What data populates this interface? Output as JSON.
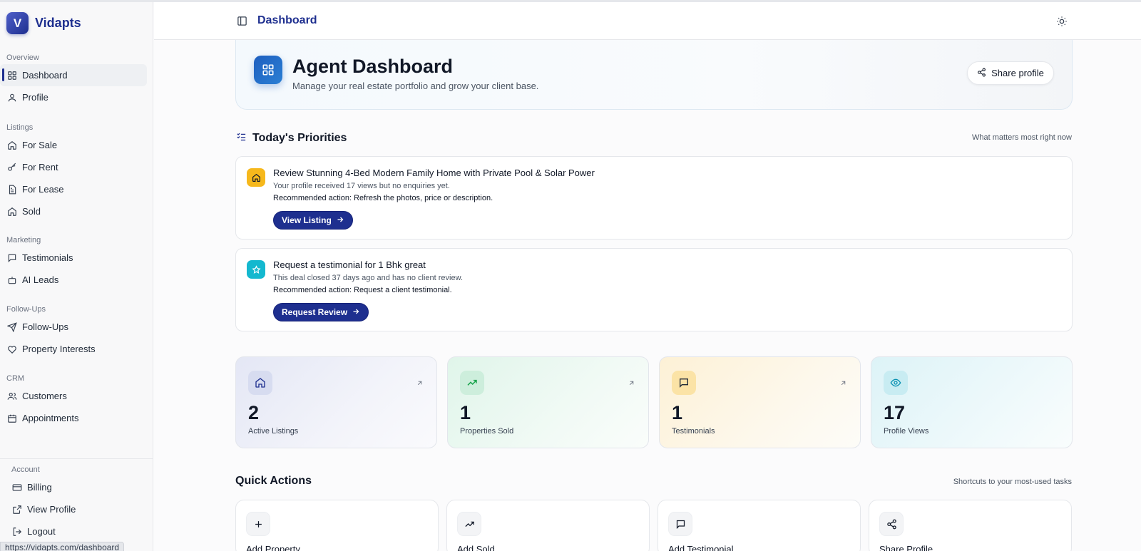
{
  "brand": {
    "logo_letter": "V",
    "name": "Vidapts"
  },
  "sidebar": {
    "sections": [
      {
        "heading": "Overview",
        "items": [
          {
            "label": "Dashboard",
            "icon": "grid-icon",
            "active": true
          },
          {
            "label": "Profile",
            "icon": "user-icon"
          }
        ]
      },
      {
        "heading": "Listings",
        "items": [
          {
            "label": "For Sale",
            "icon": "house-icon"
          },
          {
            "label": "For Rent",
            "icon": "key-icon"
          },
          {
            "label": "For Lease",
            "icon": "document-icon"
          },
          {
            "label": "Sold",
            "icon": "house-icon"
          }
        ]
      },
      {
        "heading": "Marketing",
        "items": [
          {
            "label": "Testimonials",
            "icon": "chat-icon"
          },
          {
            "label": "AI Leads",
            "icon": "bot-icon"
          }
        ]
      },
      {
        "heading": "Follow-Ups",
        "items": [
          {
            "label": "Follow-Ups",
            "icon": "send-icon"
          },
          {
            "label": "Property Interests",
            "icon": "heart-icon"
          }
        ]
      },
      {
        "heading": "CRM",
        "items": [
          {
            "label": "Customers",
            "icon": "users-icon"
          },
          {
            "label": "Appointments",
            "icon": "calendar-icon"
          }
        ]
      }
    ],
    "account": {
      "heading": "Account",
      "items": [
        {
          "label": "Billing",
          "icon": "card-icon"
        },
        {
          "label": "View Profile",
          "icon": "external-link-icon"
        },
        {
          "label": "Logout",
          "icon": "logout-icon"
        }
      ]
    },
    "status_url": "https://vidapts.com/dashboard"
  },
  "header": {
    "title": "Dashboard"
  },
  "hero": {
    "title": "Agent Dashboard",
    "subtitle": "Manage your real estate portfolio and grow your client base.",
    "share_label": "Share profile"
  },
  "priorities": {
    "title": "Today's Priorities",
    "hint": "What matters most right now",
    "items": [
      {
        "icon": "house-icon",
        "icon_bg": "#f6b81c",
        "title": "Review Stunning 4-Bed Modern Family Home with Private Pool & Solar Power",
        "desc": "Your profile received 17 views but no enquiries yet.",
        "rec": "Recommended action: Refresh the photos, price or description.",
        "button": "View Listing"
      },
      {
        "icon": "star-icon",
        "icon_bg": "#14b8cf",
        "title": "Request a testimonial for 1 Bhk great",
        "desc": "This deal closed 37 days ago and has no client review.",
        "rec": "Recommended action: Request a client testimonial.",
        "button": "Request Review"
      }
    ]
  },
  "stats": [
    {
      "value": "2",
      "label": "Active Listings",
      "icon": "house-icon"
    },
    {
      "value": "1",
      "label": "Properties Sold",
      "icon": "trending-up-icon"
    },
    {
      "value": "1",
      "label": "Testimonials",
      "icon": "chat-icon"
    },
    {
      "value": "17",
      "label": "Profile Views",
      "icon": "eye-icon"
    }
  ],
  "quick_actions": {
    "title": "Quick Actions",
    "hint": "Shortcuts to your most-used tasks",
    "items": [
      {
        "label": "Add Property",
        "icon": "plus-icon"
      },
      {
        "label": "Add Sold",
        "icon": "trending-up-icon"
      },
      {
        "label": "Add Testimonial",
        "icon": "chat-icon"
      },
      {
        "label": "Share Profile",
        "icon": "share-icon"
      }
    ]
  },
  "colors": {
    "brand": "#1e2f8f",
    "accent_blue": "#1e5fbf"
  }
}
